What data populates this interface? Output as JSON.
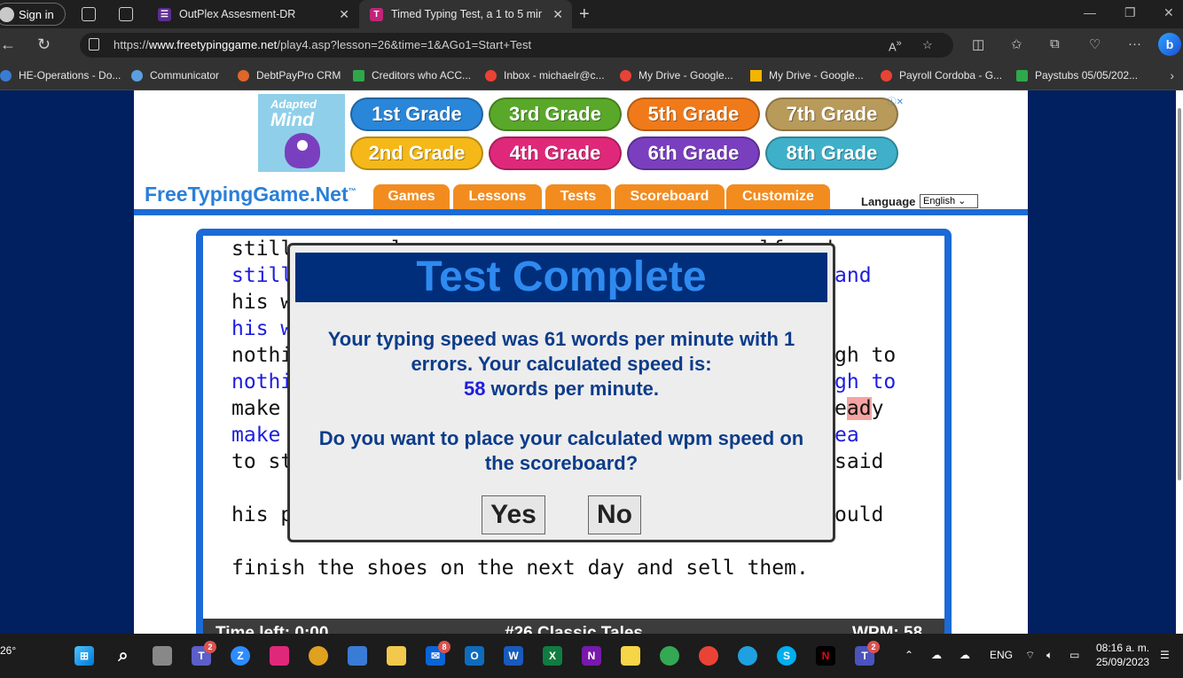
{
  "browser": {
    "signin_label": "Sign in",
    "tabs": [
      {
        "label": "OutPlex Assesment-DR",
        "favicon": "list-icon",
        "color": "#5b2d91"
      },
      {
        "label": "Timed Typing Test, a 1 to 5 minut",
        "favicon": "T",
        "color": "#c0257a"
      }
    ],
    "url_host": "www.freetypinggame.net",
    "url_prefix": "https://",
    "url_path": "/play4.asp?lesson=26&time=1&AGo1=Start+Test",
    "bookmarks": [
      "HE-Operations - Do...",
      "Communicator",
      "DebtPayPro CRM",
      "Creditors who ACC...",
      "Inbox - michaelr@c...",
      "My Drive - Google...",
      "My Drive - Google...",
      "Payroll Cordoba - G...",
      "Paystubs 05/05/202..."
    ]
  },
  "ad": {
    "brand_top": "Adapted",
    "brand_bottom": "Mind",
    "grades": [
      {
        "label": "1st Grade",
        "color": "#2a86d9"
      },
      {
        "label": "3rd Grade",
        "color": "#5aa82a"
      },
      {
        "label": "5th Grade",
        "color": "#f07a1a"
      },
      {
        "label": "7th Grade",
        "color": "#b89a5a"
      },
      {
        "label": "2nd Grade",
        "color": "#f5b818"
      },
      {
        "label": "4th Grade",
        "color": "#e0287a"
      },
      {
        "label": "6th Grade",
        "color": "#7a3fbf"
      },
      {
        "label": "8th Grade",
        "color": "#3fb0c9"
      }
    ]
  },
  "site": {
    "logo": "FreeTypingGame.Net",
    "logo_tm": "™",
    "nav": [
      "Games",
      "Lessons",
      "Tests",
      "Scoreboard",
      "Customize"
    ],
    "language_label": "Language",
    "language_value": "English"
  },
  "typing": {
    "lines": [
      {
        "text": "still        l                             lf and",
        "typed": false
      },
      {
        "text": "still",
        "typed": true,
        "tail": "and"
      },
      {
        "text": "his w",
        "typed": false
      },
      {
        "text": "his w",
        "typed": true
      },
      {
        "text": "nothi",
        "typed": false,
        "tail": "gh to"
      },
      {
        "text": "nothi",
        "typed": true,
        "tail": "gh to"
      },
      {
        "text": "make ",
        "typed": false,
        "tail_pre": "e",
        "tail_err": "ad",
        "tail_post": "y"
      },
      {
        "text": "make ",
        "typed": true,
        "tail": "ea"
      },
      {
        "text": "to st",
        "typed": false,
        "tail": "said"
      },
      {
        "text": "his p",
        "typed": false,
        "tail": "ould"
      },
      {
        "text": "finish the shoes on the next day and sell them.",
        "typed": false
      }
    ],
    "status_time": "Time left: 0:00",
    "status_lesson": "#26 Classic Tales",
    "status_wpm": "WPM: 58"
  },
  "modal": {
    "title": "Test Complete",
    "line1": "Your typing speed was 61 words per minute with 1",
    "line2": "errors. Your calculated speed is:",
    "calc_wpm": "58",
    "line3_suffix": " words per minute.",
    "question1": "Do you want to place your calculated wpm speed on",
    "question2": "the scoreboard?",
    "yes_label": "Yes",
    "no_label": "No"
  },
  "taskbar": {
    "temperature": "26°",
    "language": "ENG",
    "time": "08:16 a. m.",
    "date": "25/09/2023",
    "badges": {
      "teams": "2",
      "mail": "8",
      "typing": "2"
    }
  }
}
